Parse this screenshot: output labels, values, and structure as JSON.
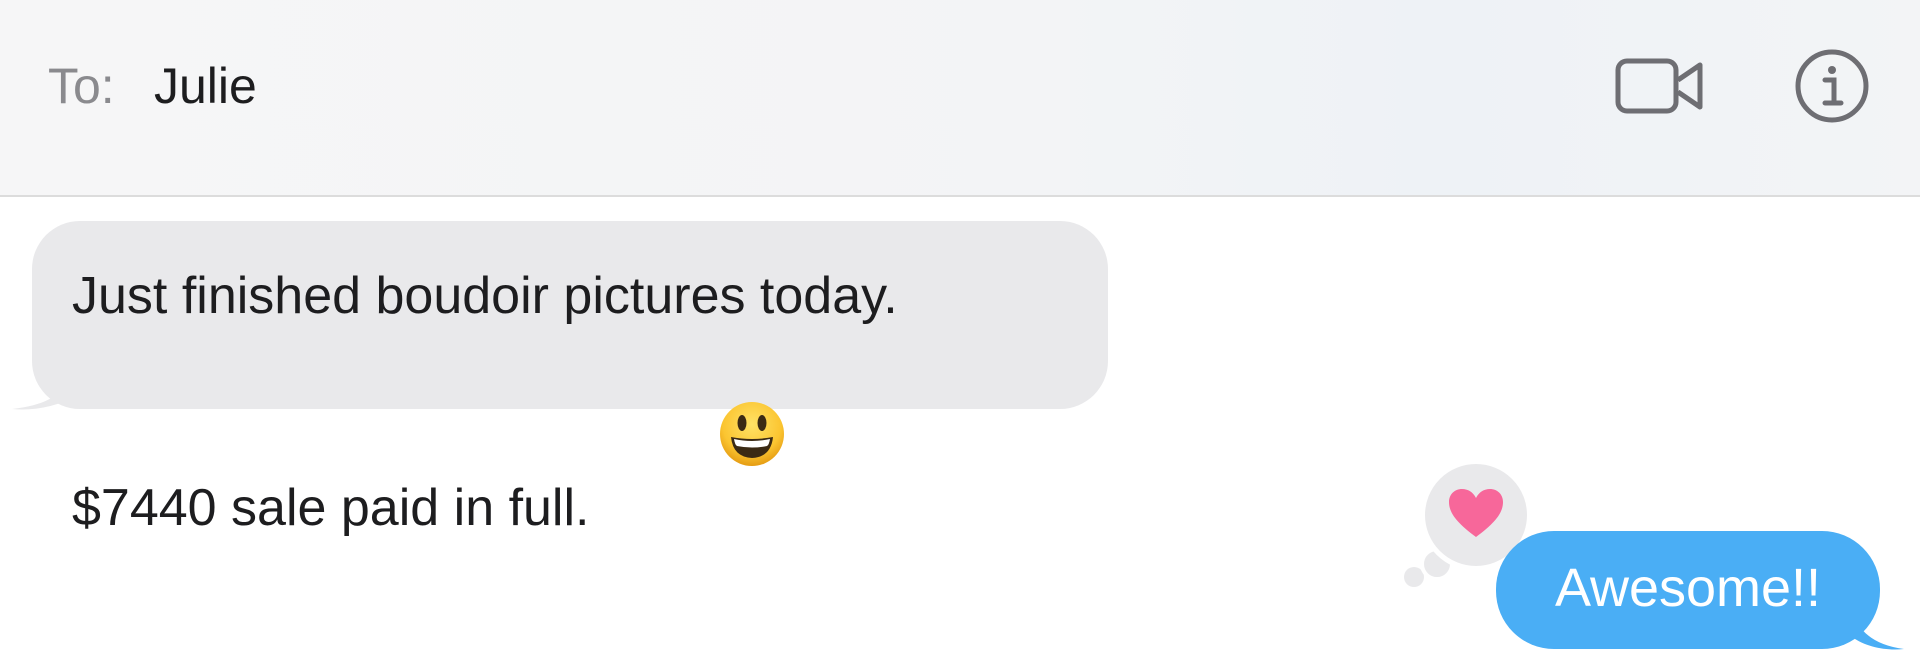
{
  "header": {
    "to_label": "To:",
    "recipient": "Julie",
    "video_icon": "video-camera-icon",
    "info_icon": "info-circle-icon"
  },
  "messages": [
    {
      "direction": "incoming",
      "line1": "Just finished boudoir pictures today.",
      "line2": "$7440 sale paid in full.",
      "emoji": "grinning-face-emoji"
    },
    {
      "direction": "outgoing",
      "text": "Awesome!!",
      "tapback": "heart-icon"
    }
  ],
  "colors": {
    "incoming_bubble": "#e9e9eb",
    "outgoing_bubble": "#4aaef5",
    "heart": "#f7679a"
  }
}
